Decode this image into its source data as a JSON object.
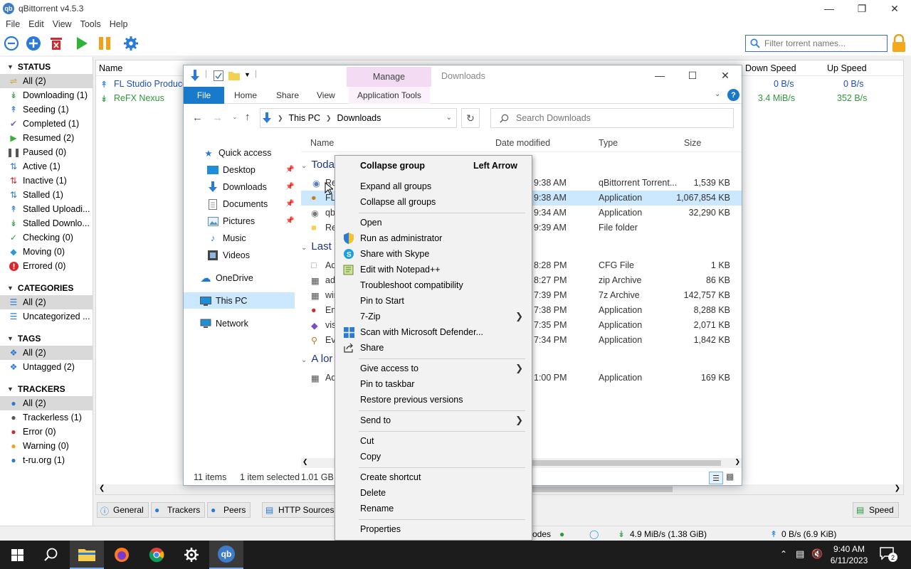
{
  "qb": {
    "title": "qBittorrent v4.5.3",
    "menu": [
      "File",
      "Edit",
      "View",
      "Tools",
      "Help"
    ],
    "filter_placeholder": "Filter torrent names...",
    "status_section": "STATUS",
    "status_items": [
      "All (2)",
      "Downloading (1)",
      "Seeding (1)",
      "Completed (1)",
      "Resumed (2)",
      "Paused (0)",
      "Active (1)",
      "Inactive (1)",
      "Stalled (1)",
      "Stalled Uploadi...",
      "Stalled Downlo...",
      "Checking (0)",
      "Moving (0)",
      "Errored (0)"
    ],
    "categories_section": "CATEGORIES",
    "category_items": [
      "All (2)",
      "Uncategorized ..."
    ],
    "tags_section": "TAGS",
    "tag_items": [
      "All (2)",
      "Untagged (2)"
    ],
    "trackers_section": "TRACKERS",
    "tracker_items": [
      "All (2)",
      "Trackerless (1)",
      "Error (0)",
      "Warning (0)",
      "t-ru.org (1)"
    ],
    "columns": {
      "name": "Name",
      "down": "Down Speed",
      "up": "Up Speed"
    },
    "torrents": [
      {
        "name": "FL Studio Produce",
        "down": "0 B/s",
        "up": "0 B/s"
      },
      {
        "name": "ReFX Nexus",
        "down": "3.4 MiB/s",
        "up": "352 B/s"
      }
    ],
    "tabs": [
      "General",
      "Trackers",
      "Peers",
      "HTTP Sources"
    ],
    "speed_tab": "Speed",
    "status_bar": {
      "nodes": "odes",
      "down": "4.9 MiB/s (1.38 GiB)",
      "up": "0 B/s (6.9 KiB)"
    }
  },
  "explorer": {
    "manage": "Manage",
    "window_title": "Downloads",
    "ribbon": {
      "file": "File",
      "home": "Home",
      "share": "Share",
      "view": "View",
      "tools": "Application Tools"
    },
    "breadcrumb": [
      "This PC",
      "Downloads"
    ],
    "search_placeholder": "Search Downloads",
    "nav": {
      "quick_access": "Quick access",
      "desktop": "Desktop",
      "downloads": "Downloads",
      "documents": "Documents",
      "pictures": "Pictures",
      "music": "Music",
      "videos": "Videos",
      "onedrive": "OneDrive",
      "thispc": "This PC",
      "network": "Network"
    },
    "columns": {
      "name": "Name",
      "date": "Date modified",
      "type": "Type",
      "size": "Size"
    },
    "groups": [
      "Toda",
      "Last",
      "A lor"
    ],
    "files": [
      {
        "name": "Re",
        "time": "9:38 AM",
        "type": "qBittorrent Torrent...",
        "size": "1,539 KB"
      },
      {
        "name": "FL",
        "time": "9:38 AM",
        "type": "Application",
        "size": "1,067,854 KB"
      },
      {
        "name": "qb",
        "time": "9:34 AM",
        "type": "Application",
        "size": "32,290 KB"
      },
      {
        "name": "Re",
        "time": "9:39 AM",
        "type": "File folder",
        "size": ""
      },
      {
        "name": "Ad",
        "time": "8:28 PM",
        "type": "CFG File",
        "size": "1 KB"
      },
      {
        "name": "adv",
        "time": "8:27 PM",
        "type": "zip Archive",
        "size": "86 KB"
      },
      {
        "name": "win",
        "time": "7:39 PM",
        "type": "7z Archive",
        "size": "142,757 KB"
      },
      {
        "name": "Em",
        "time": "7:38 PM",
        "type": "Application",
        "size": "8,288 KB"
      },
      {
        "name": "vis",
        "time": "7:35 PM",
        "type": "Application",
        "size": "2,071 KB"
      },
      {
        "name": "Eve",
        "time": "7:34 PM",
        "type": "Application",
        "size": "1,842 KB"
      },
      {
        "name": "Ad",
        "time": "1:00 PM",
        "type": "Application",
        "size": "169 KB"
      }
    ],
    "status": {
      "items": "11 items",
      "selected": "1 item selected",
      "size": "1.01 GB"
    }
  },
  "context_menu": {
    "collapse_group": "Collapse group",
    "collapse_group_shortcut": "Left Arrow",
    "expand_all": "Expand all groups",
    "collapse_all": "Collapse all groups",
    "open": "Open",
    "run_admin": "Run as administrator",
    "share_skype": "Share with Skype",
    "edit_npp": "Edit with Notepad++",
    "troubleshoot": "Troubleshoot compatibility",
    "pin_start": "Pin to Start",
    "sevenzip": "7-Zip",
    "defender": "Scan with Microsoft Defender...",
    "share": "Share",
    "give_access": "Give access to",
    "pin_taskbar": "Pin to taskbar",
    "restore": "Restore previous versions",
    "send_to": "Send to",
    "cut": "Cut",
    "copy": "Copy",
    "create_shortcut": "Create shortcut",
    "delete": "Delete",
    "rename": "Rename",
    "properties": "Properties"
  },
  "taskbar": {
    "time": "9:40 AM",
    "date": "6/11/2023",
    "notifications": "2"
  }
}
